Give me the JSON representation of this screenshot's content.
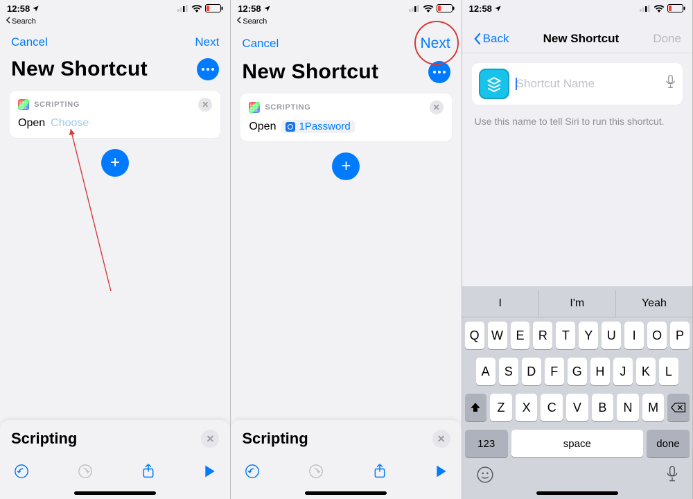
{
  "status": {
    "time": "12:58",
    "back_app": "Search"
  },
  "nav": {
    "cancel": "Cancel",
    "next": "Next",
    "back": "Back",
    "done": "Done",
    "title3": "New Shortcut"
  },
  "title": "New Shortcut",
  "card": {
    "category": "SCRIPTING",
    "open": "Open",
    "choose": "Choose",
    "app": "1Password"
  },
  "panel": {
    "title": "Scripting"
  },
  "screen3": {
    "placeholder": "Shortcut Name",
    "hint": "Use this name to tell Siri to run this shortcut."
  },
  "suggestions": [
    "I",
    "I'm",
    "Yeah"
  ],
  "keys": {
    "r1": [
      "Q",
      "W",
      "E",
      "R",
      "T",
      "Y",
      "U",
      "I",
      "O",
      "P"
    ],
    "r2": [
      "A",
      "S",
      "D",
      "F",
      "G",
      "H",
      "J",
      "K",
      "L"
    ],
    "r3": [
      "Z",
      "X",
      "C",
      "V",
      "B",
      "N",
      "M"
    ],
    "numLabel": "123",
    "space": "space",
    "done": "done"
  }
}
